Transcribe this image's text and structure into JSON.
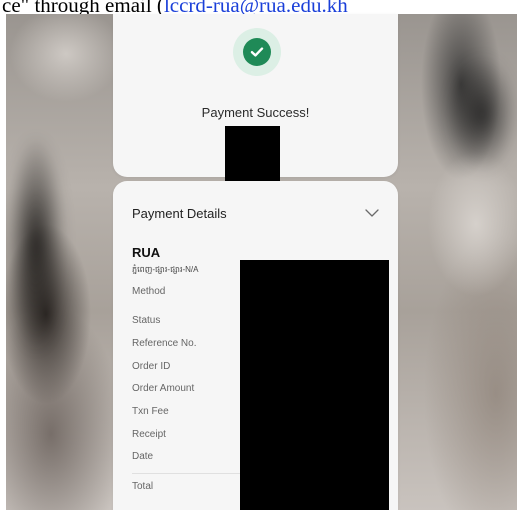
{
  "doc_line": {
    "prefix": "ce\" through email (",
    "link": "lccrd-rua@rua.edu.kh"
  },
  "success": {
    "title": "Payment Success!",
    "icon": "check-icon",
    "accent_color": "#1f8a57"
  },
  "details": {
    "title": "Payment Details",
    "chevron_icon": "chevron-down-icon",
    "merchant": "RUA",
    "merchant_sub": "ភ្នំពេញ-ផ្សារ-ផ្សារ-N/A",
    "fields": [
      {
        "label": "Method"
      },
      {
        "label": "Status"
      },
      {
        "label": "Reference No."
      },
      {
        "label": "Order ID"
      },
      {
        "label": "Order Amount"
      },
      {
        "label": "Txn Fee"
      },
      {
        "label": "Receipt"
      },
      {
        "label": "Date"
      },
      {
        "label": "Total"
      }
    ]
  }
}
